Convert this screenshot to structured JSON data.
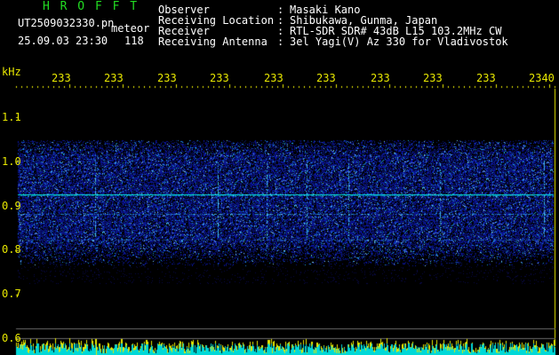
{
  "header": {
    "app_name": "H R O F F T",
    "file_name": "UT2509032330.pn",
    "mode": "meteor",
    "datetime": "25.09.03 23:30",
    "count": "118"
  },
  "info": [
    {
      "key": "Observer",
      "value": "Masaki Kano"
    },
    {
      "key": "Receiving Location",
      "value": "Shibukawa, Gunma, Japan"
    },
    {
      "key": "Receiver",
      "value": "RTL-SDR SDR# 43dB L15 103.2MHz CW"
    },
    {
      "key": "Receiving Antenna",
      "value": "3el Yagi(V) Az 330 for Vladivostok"
    }
  ],
  "axis": {
    "unit": "kHz",
    "time_ticks": [
      "233",
      "233",
      "233",
      "233",
      "233",
      "233",
      "233",
      "233",
      "233",
      "2340"
    ],
    "freq_ticks": [
      "1.1",
      "1.0",
      "0.9",
      "0.8",
      "0.7",
      "0.6"
    ]
  },
  "colors": {
    "background": "#000000",
    "title": "#22dd22",
    "axis": "#e8e800",
    "noise": "#1a2a9a",
    "carrier": "#00e0e0"
  }
}
